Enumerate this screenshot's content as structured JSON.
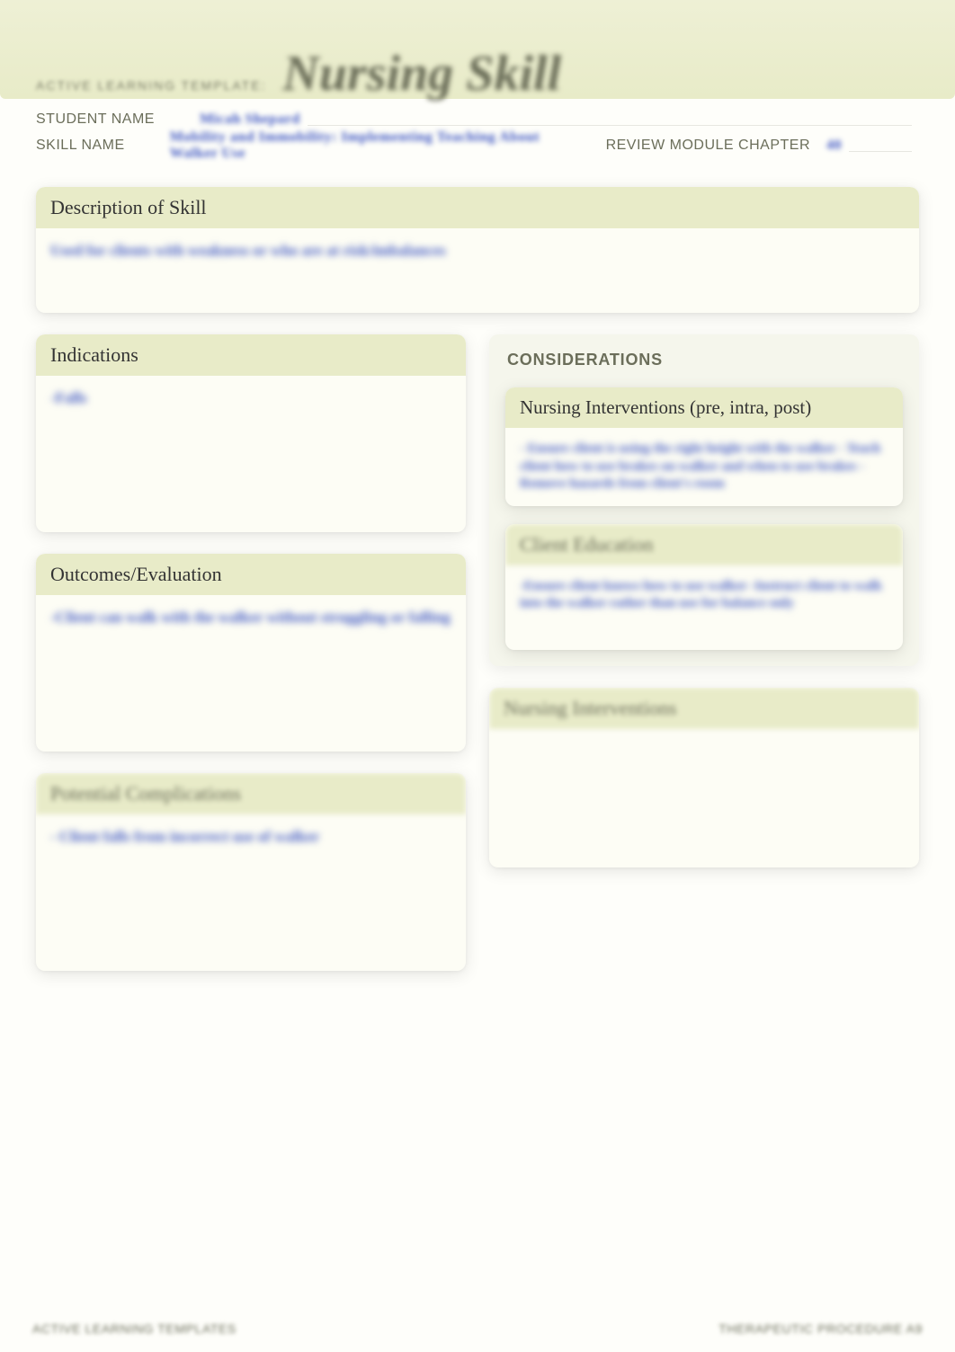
{
  "banner": {
    "template_label": "ACTIVE LEARNING TEMPLATE:",
    "title": "Nursing Skill"
  },
  "meta": {
    "student_label": "STUDENT NAME",
    "student_value": "Micah Shepard",
    "skill_label": "SKILL NAME",
    "skill_value": "Mobility and Immobility: Implementing Teaching About Walker Use",
    "review_label": "REVIEW MODULE CHAPTER",
    "review_value": "40"
  },
  "description": {
    "header": "Description of Skill",
    "body": "Used for clients with weakness or who are at risk/imbalances"
  },
  "indications": {
    "header": "Indications",
    "body": "-Falls"
  },
  "outcomes": {
    "header": "Outcomes/Evaluation",
    "body": "-Client can walk with the walker without struggling or falling"
  },
  "complications": {
    "header": "Potential Complications",
    "body": "- Client falls from incorrect use of walker"
  },
  "considerations": {
    "title": "CONSIDERATIONS",
    "interventions1": {
      "header": "Nursing Interventions (pre, intra, post)",
      "body": "- Ensure client is using the right height with the walker\n- Teach client how to use brakes on walker and when to use brakes\n- Remove hazards from client's room"
    },
    "education": {
      "header": "Client Education",
      "body": "-Ensure client knows how to use walker\n-Instruct client to walk into the walker rather than use for balance only"
    }
  },
  "interventions2": {
    "header": "Nursing Interventions",
    "body": ""
  },
  "footer": {
    "left": "ACTIVE LEARNING TEMPLATES",
    "right": "THERAPEUTIC PROCEDURE   A9"
  }
}
